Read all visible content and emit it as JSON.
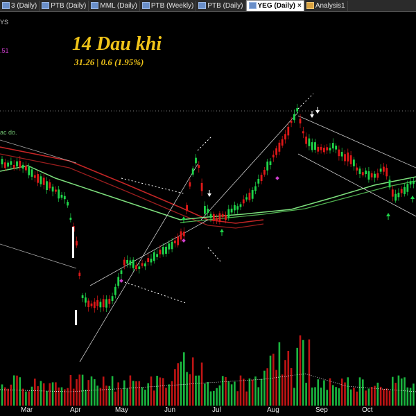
{
  "tabs": [
    {
      "label": "3 (Daily)",
      "active": false
    },
    {
      "label": "PTB (Daily)",
      "active": false
    },
    {
      "label": "MML (Daily)",
      "active": false
    },
    {
      "label": "PTB (Weekly)",
      "active": false
    },
    {
      "label": "PTB (Daily)",
      "active": false
    },
    {
      "label": "YEG (Daily)",
      "active": true
    },
    {
      "label": "Analysis1",
      "active": false
    }
  ],
  "chart": {
    "title": "14 Dau khi",
    "quote": "31.26 |   0.6 (1.95%)",
    "left_labels": {
      "top": "YS",
      "mid": ".51",
      "side": "ac do."
    },
    "months": [
      "Mar",
      "Apr",
      "May",
      "Jun",
      "Jul",
      "Aug",
      "Sep",
      "Oct"
    ],
    "colors": {
      "up": "#1fd64a",
      "down": "#e01818",
      "ma_red": "#c42525",
      "ma_green": "#7de07d",
      "title": "#f0c419"
    }
  }
}
